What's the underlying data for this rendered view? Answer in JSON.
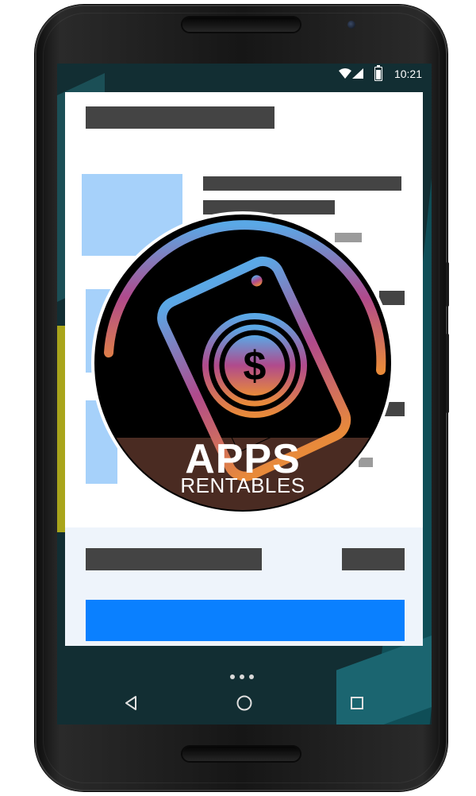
{
  "status_bar": {
    "time": "10:21",
    "icons": [
      "wifi-icon",
      "signal-icon",
      "battery-icon"
    ],
    "battery_level": 0.85
  },
  "logo": {
    "title": "APPS",
    "subtitle": "RENTABLES",
    "icons": [
      "phone-icon",
      "dollar-coin-icon"
    ],
    "colors": {
      "background": "#000000",
      "gradient_top": "#5aa8e6",
      "gradient_mid": "#b04a8c",
      "gradient_bottom": "#e88a3a",
      "banner": "#4a2b22"
    }
  },
  "navigation": {
    "buttons": [
      "back-icon",
      "home-icon",
      "recents-icon"
    ],
    "page_dots": 3
  },
  "colors": {
    "placeholder_bar": "#444444",
    "thumbnail": "#a6d1fa",
    "cta": "#0a80ff",
    "footer_bg": "#eef4fb"
  }
}
